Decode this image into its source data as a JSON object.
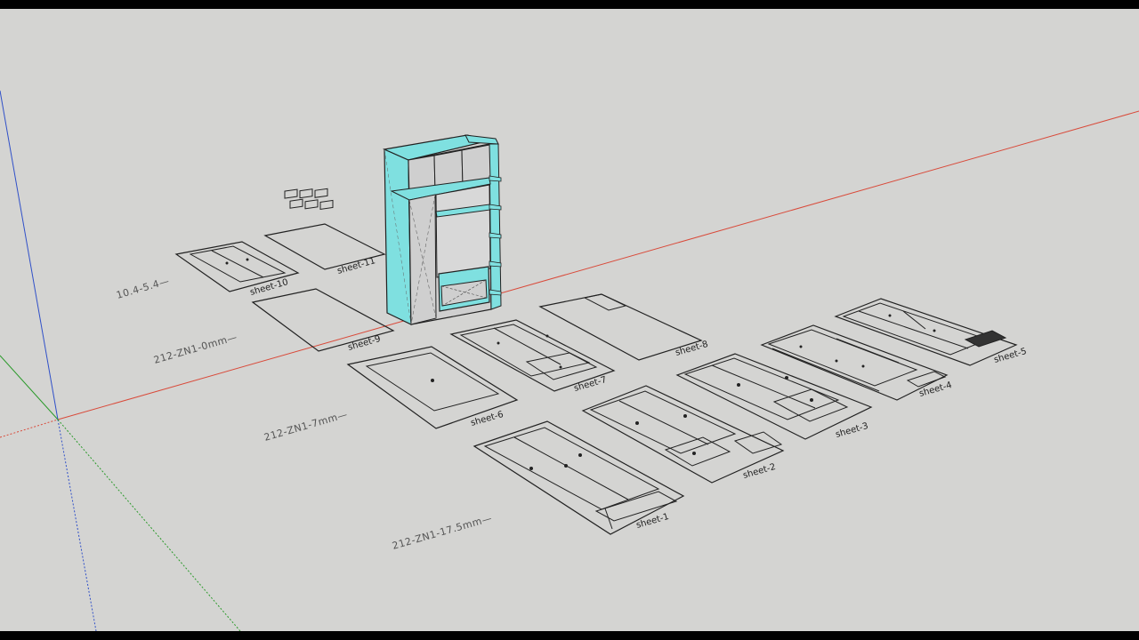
{
  "scene": {
    "background": "#d4d4d2",
    "axis_colors": {
      "red": "#d94a3a",
      "green": "#2c9a2c",
      "blue": "#3050c8"
    },
    "cabinet_color": "#7fe0e0"
  },
  "material_labels": {
    "m1": "10.4-5.4—",
    "m2": "212-ZN1-0mm—",
    "m3": "212-ZN1-7mm—",
    "m4": "212-ZN1-17.5mm—"
  },
  "sheet_labels": {
    "s1": "sheet-1",
    "s2": "sheet-2",
    "s3": "sheet-3",
    "s4": "sheet-4",
    "s5": "sheet-5",
    "s6": "sheet-6",
    "s7": "sheet-7",
    "s8": "sheet-8",
    "s9": "sheet-9",
    "s10": "sheet-10",
    "s11": "sheet-11"
  }
}
